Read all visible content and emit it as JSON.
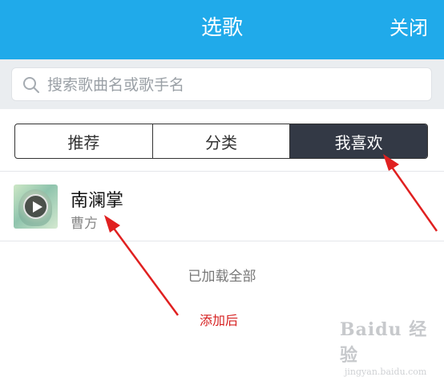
{
  "header": {
    "title": "选歌",
    "close_label": "关闭",
    "bg_color": "#20aaea"
  },
  "search": {
    "placeholder": "搜索歌曲名或歌手名",
    "icon": "search-icon"
  },
  "tabs": [
    {
      "label": "推荐",
      "active": false
    },
    {
      "label": "分类",
      "active": false
    },
    {
      "label": "我喜欢",
      "active": true
    }
  ],
  "songs": [
    {
      "title": "南澜掌",
      "artist": "曹方",
      "icon": "play-icon"
    }
  ],
  "list_footer": {
    "loaded_text": "已加载全部"
  },
  "annotation": {
    "text": "添加后",
    "color": "#d62020"
  },
  "watermark": {
    "brand": "Baidu 经验",
    "url": "jingyan.baidu.com"
  }
}
